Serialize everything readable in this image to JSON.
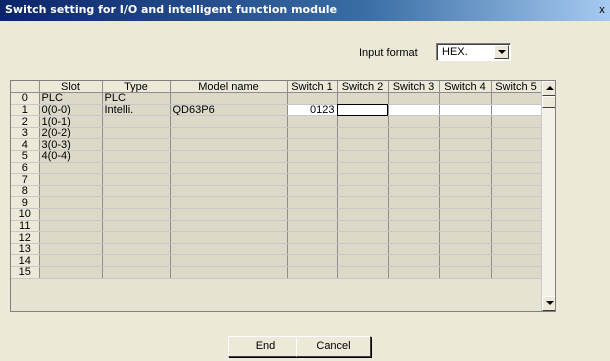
{
  "window": {
    "title": "Switch setting for I/O and intelligent function module",
    "close_glyph": "x"
  },
  "input_format": {
    "label": "Input format",
    "value": "HEX."
  },
  "table": {
    "columns": [
      "",
      "Slot",
      "Type",
      "Model name",
      "Switch 1",
      "Switch 2",
      "Switch 3",
      "Switch 4",
      "Switch 5"
    ],
    "rows": [
      {
        "num": "0",
        "slot": "PLC",
        "type": "PLC",
        "model": "",
        "s1": "",
        "s2": "",
        "s3": "",
        "s4": "",
        "s5": ""
      },
      {
        "num": "1",
        "slot": "0(0-0)",
        "type": "Intelli.",
        "model": "QD63P6",
        "s1": "0123",
        "s2": "",
        "s3": "",
        "s4": "",
        "s5": ""
      },
      {
        "num": "2",
        "slot": "1(0-1)",
        "type": "",
        "model": "",
        "s1": "",
        "s2": "",
        "s3": "",
        "s4": "",
        "s5": ""
      },
      {
        "num": "3",
        "slot": "2(0-2)",
        "type": "",
        "model": "",
        "s1": "",
        "s2": "",
        "s3": "",
        "s4": "",
        "s5": ""
      },
      {
        "num": "4",
        "slot": "3(0-3)",
        "type": "",
        "model": "",
        "s1": "",
        "s2": "",
        "s3": "",
        "s4": "",
        "s5": ""
      },
      {
        "num": "5",
        "slot": "4(0-4)",
        "type": "",
        "model": "",
        "s1": "",
        "s2": "",
        "s3": "",
        "s4": "",
        "s5": ""
      },
      {
        "num": "6",
        "slot": "",
        "type": "",
        "model": "",
        "s1": "",
        "s2": "",
        "s3": "",
        "s4": "",
        "s5": ""
      },
      {
        "num": "7",
        "slot": "",
        "type": "",
        "model": "",
        "s1": "",
        "s2": "",
        "s3": "",
        "s4": "",
        "s5": ""
      },
      {
        "num": "8",
        "slot": "",
        "type": "",
        "model": "",
        "s1": "",
        "s2": "",
        "s3": "",
        "s4": "",
        "s5": ""
      },
      {
        "num": "9",
        "slot": "",
        "type": "",
        "model": "",
        "s1": "",
        "s2": "",
        "s3": "",
        "s4": "",
        "s5": ""
      },
      {
        "num": "10",
        "slot": "",
        "type": "",
        "model": "",
        "s1": "",
        "s2": "",
        "s3": "",
        "s4": "",
        "s5": ""
      },
      {
        "num": "11",
        "slot": "",
        "type": "",
        "model": "",
        "s1": "",
        "s2": "",
        "s3": "",
        "s4": "",
        "s5": ""
      },
      {
        "num": "12",
        "slot": "",
        "type": "",
        "model": "",
        "s1": "",
        "s2": "",
        "s3": "",
        "s4": "",
        "s5": ""
      },
      {
        "num": "13",
        "slot": "",
        "type": "",
        "model": "",
        "s1": "",
        "s2": "",
        "s3": "",
        "s4": "",
        "s5": ""
      },
      {
        "num": "14",
        "slot": "",
        "type": "",
        "model": "",
        "s1": "",
        "s2": "",
        "s3": "",
        "s4": "",
        "s5": ""
      },
      {
        "num": "15",
        "slot": "",
        "type": "",
        "model": "",
        "s1": "",
        "s2": "",
        "s3": "",
        "s4": "",
        "s5": ""
      }
    ]
  },
  "buttons": {
    "end": "End",
    "cancel": "Cancel"
  },
  "colors": {
    "title_bar": "#0a246a",
    "dialog_bg": "#ece9d8",
    "cell_bg": "#dcd9c8"
  }
}
